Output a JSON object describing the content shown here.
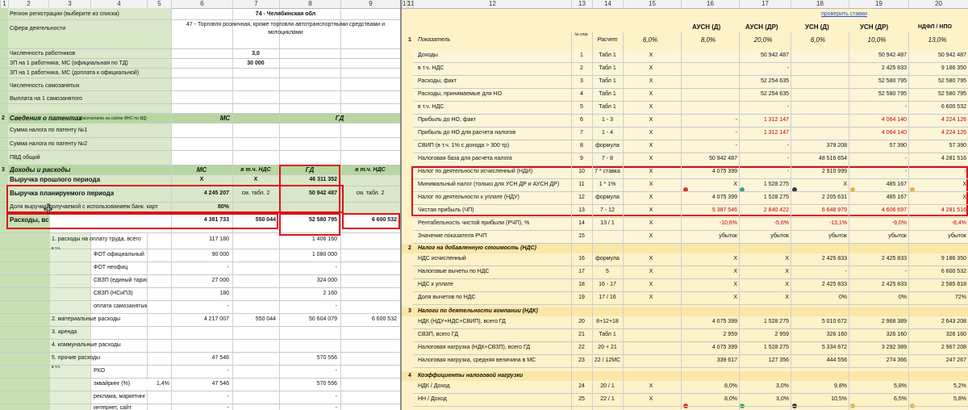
{
  "left": {
    "col_headers": [
      "1",
      "2",
      "3",
      "4",
      "5",
      "6",
      "7",
      "8",
      "9"
    ],
    "region_label": "Регион регистрации (выберите из списка)",
    "region_value": "74 - Челябинская обл",
    "activity_label": "Сфера деятельности",
    "activity_value": "47 - Торговля розничная, кроме торговли автотранспортными средствами и мотоциклами",
    "workers_label": "Численность работников",
    "workers_value": "3,0",
    "salary_label": "ЗП на 1 работника, МС (официальная по ТД)",
    "salary_value": "30 000",
    "salary2_label": "ЗП на 1 работника, МС (доплата к официальной)",
    "selfemp_label": "Численность самозанятых",
    "selfemp_pay_label": "Выплата на 1 самозанятого",
    "patents_num": "2",
    "patents_title": "Сведения о патентах",
    "patents_note": "(рассчитать на сайте ФНС по ВД)",
    "patents_ms": "МС",
    "patents_gd": "ГД",
    "patent1_label": "Сумма налога по патенту №1",
    "patent2_label": "Сумма налога по патенту №2",
    "pvd_label": "ПВД общий",
    "income_num": "3",
    "income_title": "Доходы и расходы",
    "hdr_ms": "МС",
    "hdr_vat": "в т.ч. НДС",
    "hdr_gd": "ГД",
    "hdr_vat2": "в т.ч. НДС",
    "prev_label": "Выручка прошлого периода",
    "prev_ms": "X",
    "prev_vat": "X",
    "prev_gd": "46 311 352",
    "plan_label": "Выручка планируемого периода",
    "plan_ms": "4 245 207",
    "plan_vat": "см. табл. 2",
    "plan_gd": "50 942 487",
    "plan_vat2": "см. табл. 2",
    "bank_label": "Доля выручки, получаемой с использованием банк. карт",
    "bank_value": "80%",
    "exp_label": "Расходы, вс",
    "exp_ms": "4 381 733",
    "exp_vat": "550 044",
    "exp_gd": "52 580 795",
    "exp_vat2": "6 600 532",
    "vtch": "в т.ч.",
    "wages_label": "1. расходы на оплату труда, всего",
    "wages_ms": "117 180",
    "wages_gd": "1 406 160",
    "fot_label": "ФОТ официальный",
    "fot_ms": "90 000",
    "fot_gd": "1 080 000",
    "fotn_label": "ФОТ неофиц",
    "fotn_ms": "-",
    "fotn_gd": "-",
    "svz1_label": "СВЗП (единый тариф)",
    "svz1_ms": "27 000",
    "svz1_gd": "324 000",
    "svz2_label": "СВЗП (НСиПЗ)",
    "svz2_ms": "180",
    "svz2_gd": "2 160",
    "selfpay_label": "оплата самозанятым",
    "selfpay_ms": "-",
    "selfpay_gd": "-",
    "mat_label": "2. материальные расходы",
    "mat_ms": "4 217 007",
    "mat_vat": "550 044",
    "mat_gd": "50 604 079",
    "mat_vat2": "6 600 532",
    "rent_label": "3. аренда",
    "comm_label": "4. коммунальные расходы",
    "other_label": "5. прочие расходы",
    "other_ms": "47 546",
    "other_gd": "570 556",
    "rko_label": "РКО",
    "rko_ms": "-",
    "rko_gd": "-",
    "acq_label": "эквайринг (%)",
    "acq_pct": "1,4%",
    "acq_ms": "47 546",
    "acq_gd": "570 556",
    "ads_label": "реклама, маркетинг",
    "ads_ms": "-",
    "ads_gd": "-",
    "net_label": "интернет, сайт",
    "net_ms": "-",
    "net_gd": "-"
  },
  "right": {
    "col_headers": [
      "10",
      "11",
      "12",
      "13",
      "14",
      "15",
      "16",
      "17",
      "18",
      "19",
      "20"
    ],
    "link": "проверить ставки",
    "title_num": "1",
    "title_label": "Показатель",
    "hdr_no": "№ стр.",
    "hdr_calc": "Расчет",
    "regimes": [
      "АУСН (Д)",
      "АУСН (ДР)",
      "УСН (Д)",
      "УСН (ДР)",
      "НДФЛ / НПО"
    ],
    "rates": [
      "6,0%",
      "8,0%",
      "20,0%",
      "6,0%",
      "10,0%",
      "13,0%"
    ],
    "rows": [
      {
        "label": "Доходы",
        "no": "1",
        "calc": "Табл 1",
        "v": [
          "X",
          "",
          "50 942 487",
          "",
          "50 942 487",
          "50 942 487"
        ]
      },
      {
        "label": "в т.ч. НДС",
        "no": "2",
        "calc": "Табл 1",
        "v": [
          "X",
          "",
          "-",
          "",
          "2 425 833",
          "9 186 350"
        ]
      },
      {
        "label": "Расходы, факт",
        "no": "3",
        "calc": "Табл 1",
        "v": [
          "X",
          "",
          "52 254 635",
          "",
          "52 580 795",
          "52 580 795"
        ]
      },
      {
        "label": "Расходы, принимаемые для НО",
        "no": "4",
        "calc": "Табл 1",
        "v": [
          "X",
          "",
          "52 254 635",
          "",
          "52 580 795",
          "52 580 795"
        ]
      },
      {
        "label": "в т.ч. НДС",
        "no": "5",
        "calc": "Табл 1",
        "v": [
          "X",
          "",
          "-",
          "",
          "-",
          "6 600 532"
        ]
      },
      {
        "label": "Прибыль до НО, факт",
        "no": "6",
        "calc": "1 - 3",
        "v": [
          "X",
          "-",
          "1 312 147",
          "",
          "4 064 140",
          "4 224 126"
        ]
      },
      {
        "label": "Прибыль до НО для расчета налогов",
        "no": "7",
        "calc": "1 - 4",
        "v": [
          "X",
          "-",
          "1 312 147",
          "",
          "4 064 140",
          "4 224 126"
        ]
      },
      {
        "label": "СВИП (в т.ч. 1% с дохода > 300 тр)",
        "no": "8",
        "calc": "формула",
        "v": [
          "X",
          "-",
          "-",
          "379 208",
          "57 390",
          "57 390"
        ]
      },
      {
        "label": "Налоговая база для расчета налога",
        "no": "9",
        "calc": "7 - 8",
        "v": [
          "X",
          "50 942 487",
          "-",
          "48 516 654",
          "-",
          "4 281 516"
        ]
      },
      {
        "label": "Налог по деятельности исчисленный (НДИ)",
        "no": "10",
        "calc": "7 * ставка",
        "v": [
          "X",
          "4 075 399",
          "-",
          "2 910 999",
          "-",
          "-"
        ]
      },
      {
        "label": "Минимальный налог (только для УСН ДР и АУСН ДР)",
        "no": "11",
        "calc": "1 * 1%",
        "v": [
          "X",
          "X",
          "1 528 275",
          "X",
          "485 167",
          "X"
        ]
      },
      {
        "label": "Налог по деятельности к уплате (НДУ)",
        "no": "12",
        "calc": "формула",
        "v": [
          "X",
          "4 075 399",
          "1 528 275",
          "2 205 631",
          "485 167",
          "X"
        ]
      },
      {
        "label": "Чистая прибыль (ЧП)",
        "no": "13",
        "calc": "7 - 12",
        "v": [
          "X",
          "5 387 546",
          "2 840 422",
          "6 648 979",
          "4 606 697",
          "4 281 516"
        ]
      },
      {
        "label": "Рентабельность чистой прибыли (РЧП), %",
        "no": "14",
        "calc": "13 / 1",
        "v": [
          "X",
          "-10,6%",
          "-5,6%",
          "-13,1%",
          "-9,0%",
          "-8,4%"
        ]
      },
      {
        "label": "Значение показателя РЧП",
        "no": "15",
        "calc": "",
        "v": [
          "X",
          "убыток",
          "убыток",
          "убыток",
          "убыток",
          "убыток"
        ]
      }
    ],
    "sec2_num": "2",
    "sec2_title": "Налог на добавленную стоимость (НДС)",
    "sec2_rows": [
      {
        "label": "НДС исчисленный",
        "no": "16",
        "calc": "формула",
        "v": [
          "X",
          "X",
          "X",
          "2 425 833",
          "2 425 833",
          "9 186 350"
        ]
      },
      {
        "label": "Налоговые вычеты по НДС",
        "no": "17",
        "calc": "5",
        "v": [
          "X",
          "X",
          "X",
          "-",
          "-",
          "6 600 532"
        ]
      },
      {
        "label": "НДС к уплате",
        "no": "18",
        "calc": "16 - 17",
        "v": [
          "X",
          "X",
          "X",
          "2 425 833",
          "2 425 833",
          "2 585 818"
        ]
      },
      {
        "label": "Доля вычетов по НДС",
        "no": "19",
        "calc": "17 / 16",
        "v": [
          "X",
          "X",
          "X",
          "0%",
          "0%",
          "72%"
        ]
      }
    ],
    "sec3_num": "3",
    "sec3_title": "Налоги по деятельности компании (НДК)",
    "sec3_rows": [
      {
        "label": "НДК (НДУ+НДС+СВИП), всего ГД",
        "no": "20",
        "calc": "8+12+18",
        "v": [
          "",
          "4 075 399",
          "1 528 275",
          "5 010 672",
          "2 968 389",
          "2 643 208"
        ]
      },
      {
        "label": "СВЗП, всего ГД",
        "no": "21",
        "calc": "Табл 1",
        "v": [
          "",
          "2 959",
          "2 959",
          "326 160",
          "326 160",
          "326 160"
        ]
      },
      {
        "label": "Налоговая нагрузка (НДК+СВЗП), всего ГД",
        "no": "22",
        "calc": "20 + 21",
        "v": [
          "",
          "4 075 399",
          "1 528 275",
          "5 334 672",
          "3 292 389",
          "2 967 208"
        ]
      },
      {
        "label": "Налоговая нагрузка, средняя величина в МС",
        "no": "23",
        "calc": "22 / 12МС",
        "v": [
          "",
          "339 617",
          "127 356",
          "444 556",
          "274 366",
          "247 267"
        ]
      }
    ],
    "sec4_num": "4",
    "sec4_title": "Коэффициенты налоговой нагрузки",
    "sec4_rows": [
      {
        "label": "НДК / Доход",
        "no": "24",
        "calc": "20 / 1",
        "v": [
          "X",
          "8,0%",
          "3,0%",
          "9,8%",
          "5,8%",
          "5,2%"
        ]
      },
      {
        "label": "НН / Доход",
        "no": "25",
        "calc": "22 / 1",
        "v": [
          "X",
          "8,0%",
          "3,0%",
          "10,5%",
          "6,5%",
          "5,8%"
        ]
      }
    ],
    "dot_colors": {
      "red": "#d9362b",
      "teal": "#3aa37d",
      "dark": "#3a3a3a",
      "amber": "#e8b53a",
      "red2": "#c0392b"
    }
  }
}
